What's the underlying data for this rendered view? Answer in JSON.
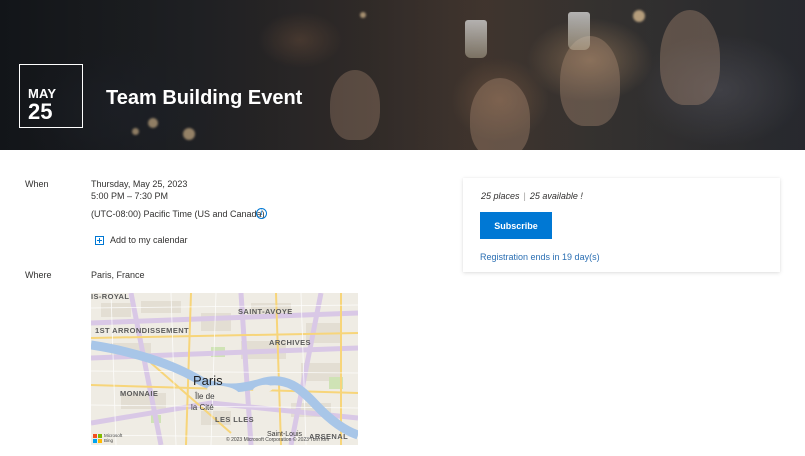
{
  "event": {
    "month": "MAY",
    "day": "25",
    "title": "Team Building Event"
  },
  "details": {
    "when_label": "When",
    "date": "Thursday, May 25, 2023",
    "time": "5:00 PM – 7:30 PM",
    "timezone": "(UTC-08:00) Pacific Time (US and Canada)",
    "info_icon": "info-icon",
    "add_calendar": "Add to my calendar",
    "where_label": "Where",
    "location": "Paris, France"
  },
  "map": {
    "city": "Paris",
    "labels": {
      "royal": "IS-ROYAL",
      "arrondissement": "1ST ARRONDISSEMENT",
      "saint_avoye": "SAINT-AVOYE",
      "archives": "ARCHIVES",
      "monnaie": "MONNAIE",
      "les_halles": "LES LLES",
      "arsenal": "ARSENAL",
      "ile_de_la": "Île de",
      "la_cite": "la Cité",
      "saint_louis": "Saint-Louis"
    },
    "copyright": "© 2023 Microsoft Corporation © 2023 TomTom",
    "provider_line1": "Microsoft",
    "provider_line2": "Bing"
  },
  "subscription": {
    "places": "25 places",
    "separator": "|",
    "available": "25 available !",
    "button": "Subscribe",
    "registration": "Registration ends in 19 day(s)"
  },
  "colors": {
    "accent": "#0078d4",
    "link": "#2b6fb3",
    "river": "#a8c6e8",
    "major_road": "#d9c8e6",
    "minor_road": "#f7d57a"
  }
}
